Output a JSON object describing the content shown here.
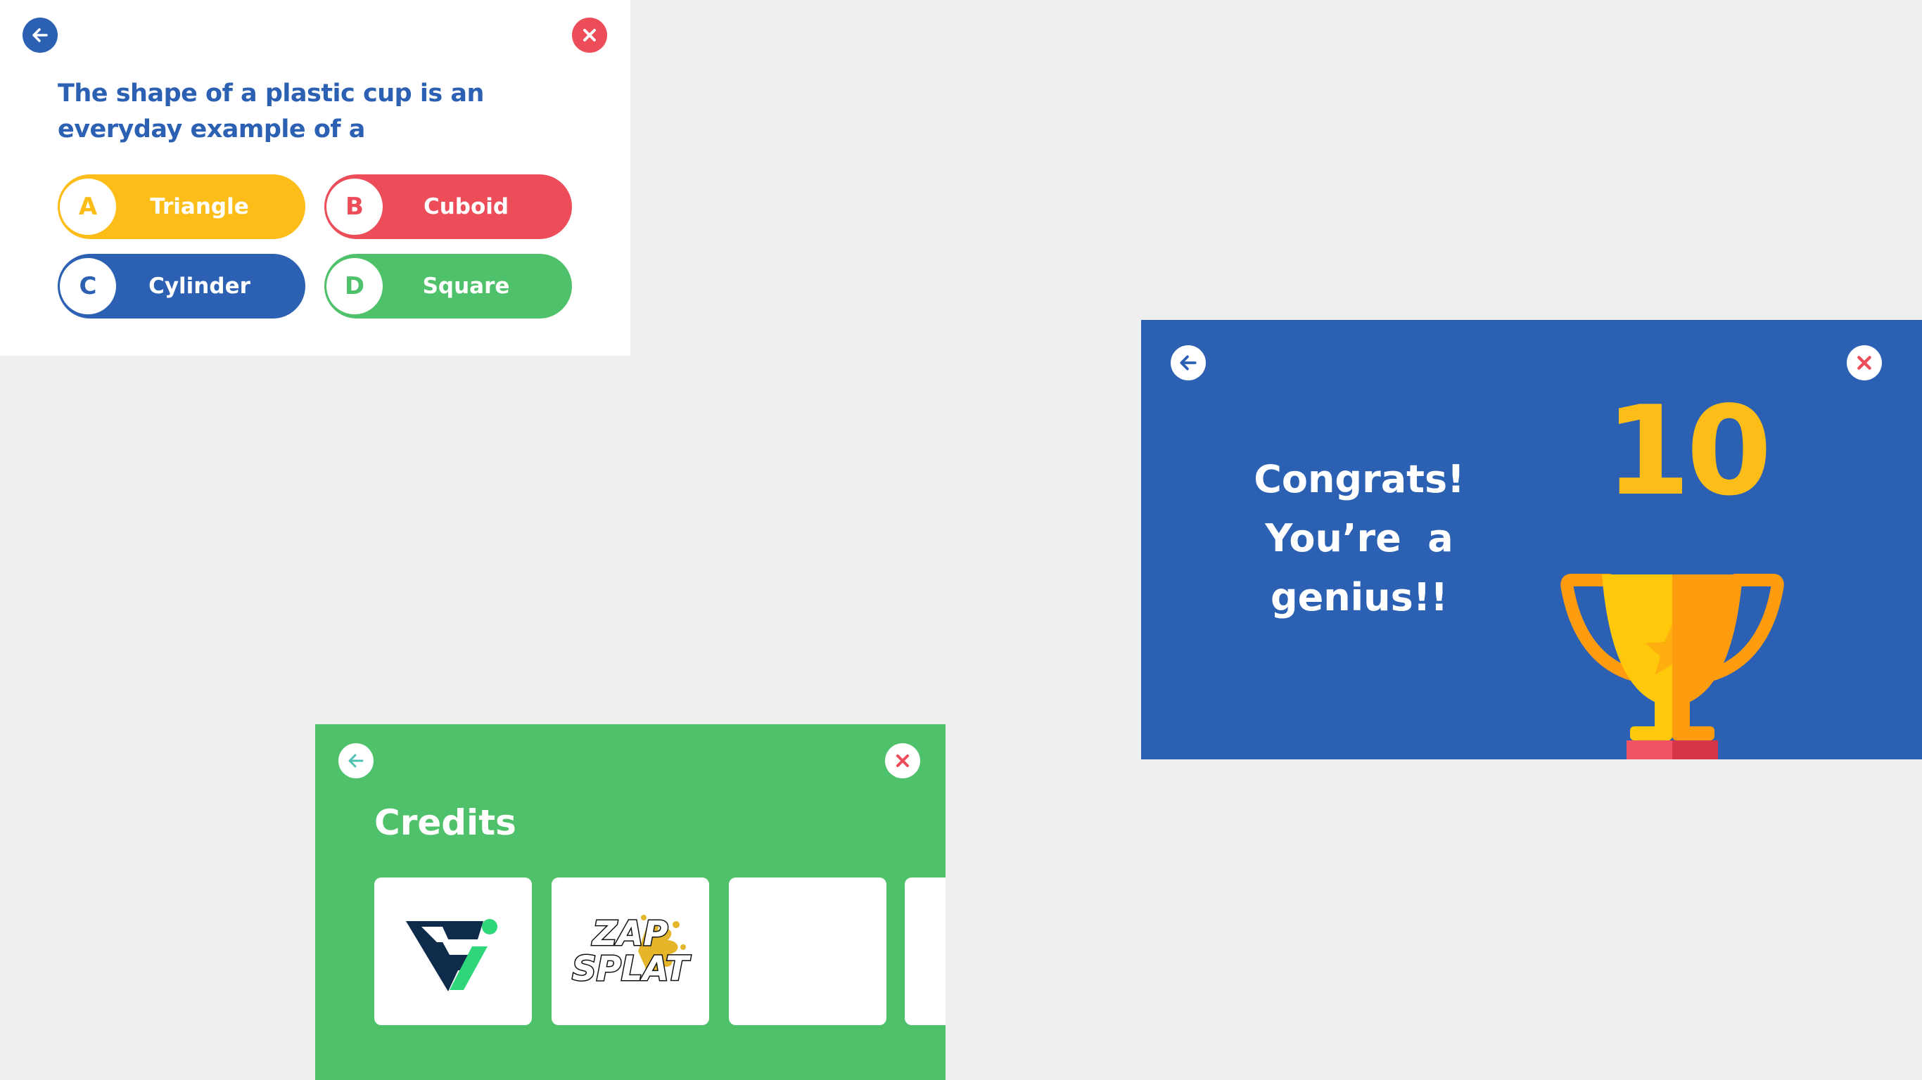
{
  "quiz": {
    "question": "The shape of a plastic cup is an everyday example of a",
    "options": [
      {
        "letter": "A",
        "label": "Triangle"
      },
      {
        "letter": "B",
        "label": "Cuboid"
      },
      {
        "letter": "C",
        "label": "Cylinder"
      },
      {
        "letter": "D",
        "label": "Square"
      }
    ],
    "colors": {
      "blue": "#2b60b3",
      "red": "#ed4c59",
      "yellow": "#fdbd18",
      "green": "#4fc16a"
    }
  },
  "result": {
    "message_lines": [
      "Congrats!",
      "You’re  a",
      "genius!!"
    ],
    "score": "10",
    "icons": [
      "back-arrow-icon",
      "close-icon",
      "trophy-icon"
    ]
  },
  "credits": {
    "title": "Credits",
    "cards": [
      {
        "name": "fi-logo"
      },
      {
        "name": "zapsplat-logo",
        "text": "ZAP SPLAT"
      },
      {
        "name": "empty-card"
      },
      {
        "name": "partial-card"
      }
    ]
  }
}
